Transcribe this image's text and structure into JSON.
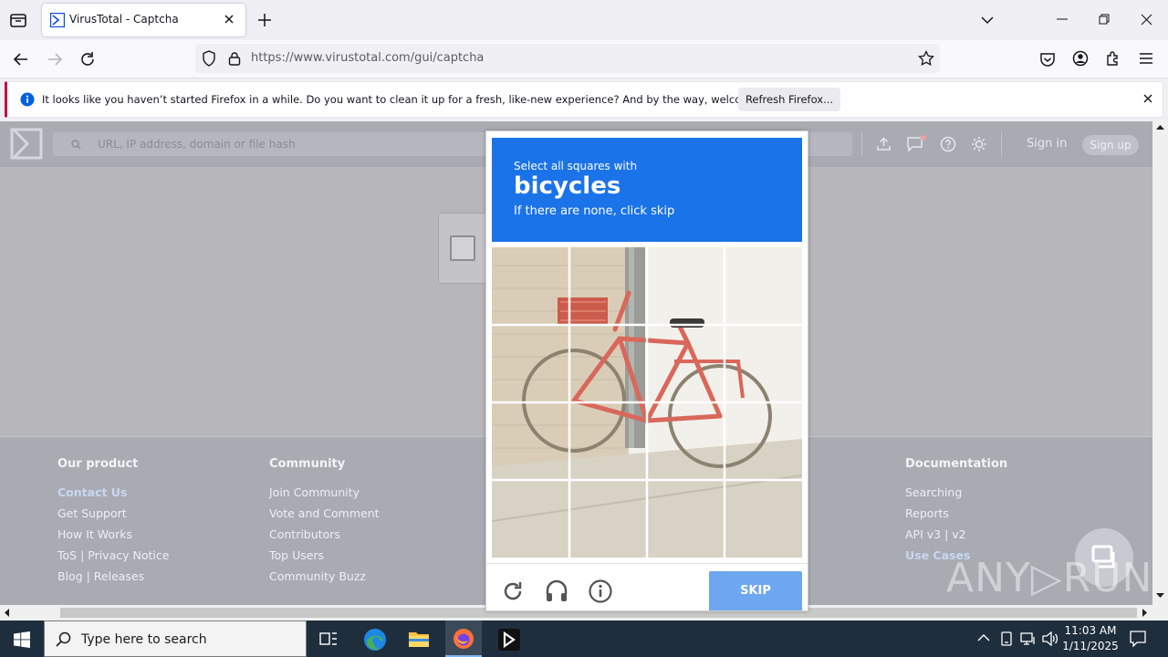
{
  "browser": {
    "tab_title": "VirusTotal - Captcha",
    "url": "https://www.virustotal.com/gui/captcha",
    "notification": {
      "message": "It looks like you haven’t started Firefox in a while. Do you want to clean it up for a fresh, like-new experience? And by the way, welcome back!",
      "button": "Refresh Firefox..."
    }
  },
  "vt": {
    "search_placeholder": "URL, IP address, domain or file hash",
    "sign_in": "Sign in",
    "sign_up": "Sign up"
  },
  "footer": {
    "columns": [
      {
        "title": "Our product",
        "links": [
          "Contact Us",
          "Get Support",
          "How It Works",
          "ToS | Privacy Notice",
          "Blog | Releases"
        ]
      },
      {
        "title": "Community",
        "links": [
          "Join Community",
          "Vote and Comment",
          "Contributors",
          "Top Users",
          "Community Buzz"
        ]
      },
      {
        "title": "Documentation",
        "links": [
          "Searching",
          "Reports",
          "API v3 | v2",
          "Use Cases"
        ]
      }
    ]
  },
  "captcha": {
    "line1": "Select all squares with",
    "target": "bicycles",
    "line3": "If there are none, click skip",
    "skip": "SKIP"
  },
  "taskbar": {
    "search_placeholder": "Type here to search",
    "time": "11:03 AM",
    "date": "1/11/2025"
  },
  "watermark": "ANY▷RUN",
  "colors": {
    "captcha_header": "#1a73e8",
    "skip_button": "#6ea6ef",
    "taskbar": "#1f2e3c"
  }
}
